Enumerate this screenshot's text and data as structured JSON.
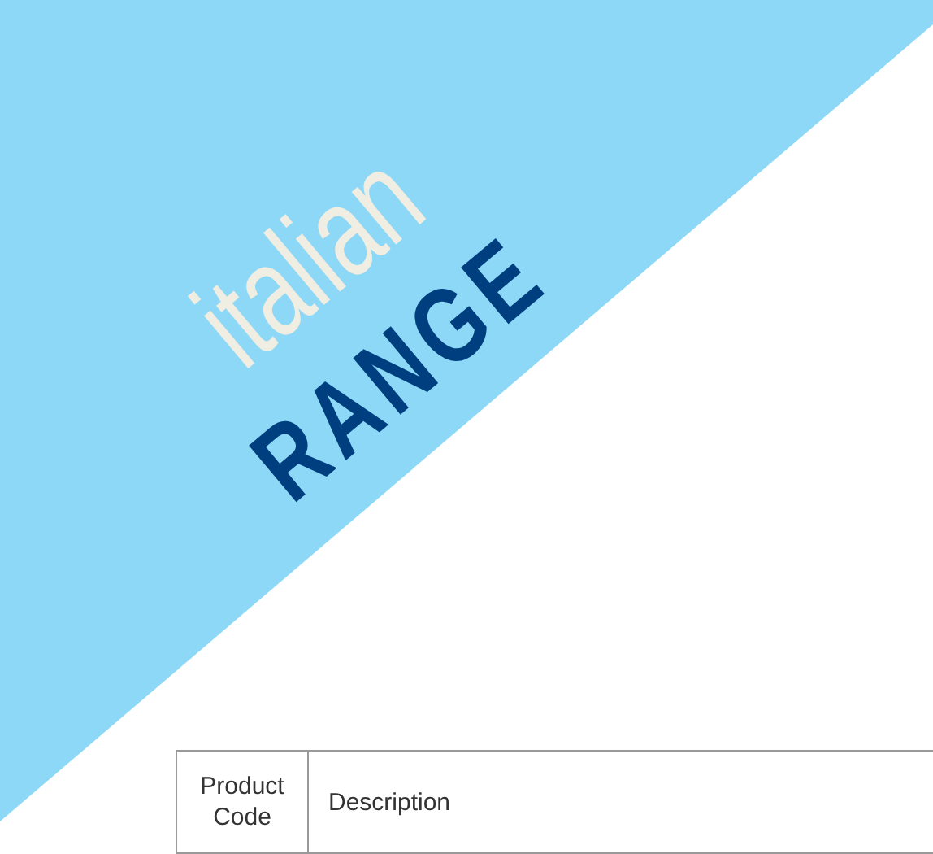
{
  "banner": {
    "title": "italian",
    "subtitle": "RANGE"
  },
  "table": {
    "columns": [
      "Product Code",
      "Description"
    ]
  }
}
